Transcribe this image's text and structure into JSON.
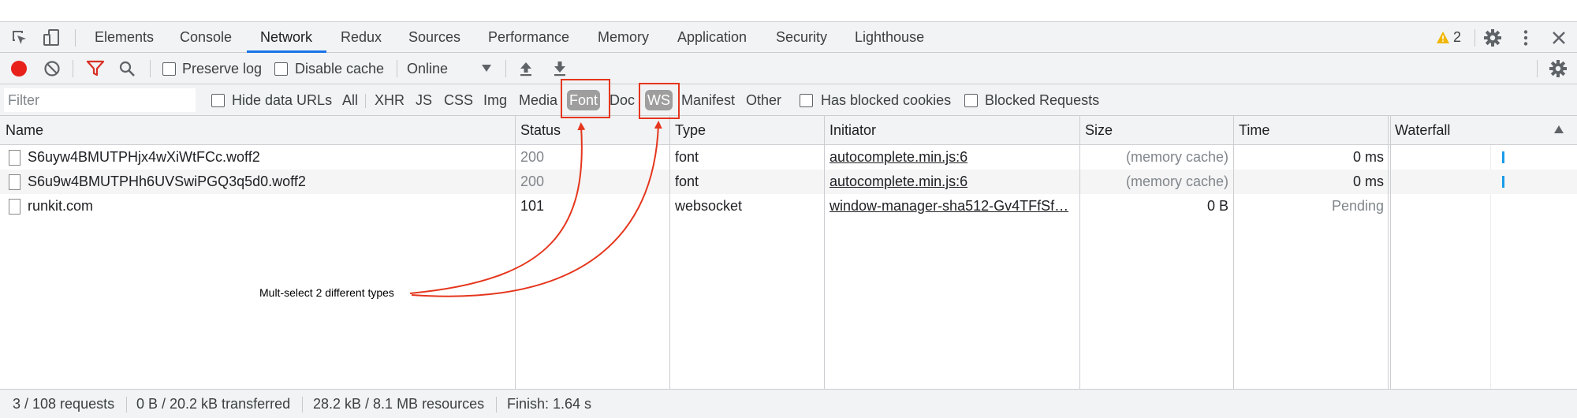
{
  "tabs": [
    {
      "label": "Elements"
    },
    {
      "label": "Console"
    },
    {
      "label": "Network",
      "active": true
    },
    {
      "label": "Redux"
    },
    {
      "label": "Sources"
    },
    {
      "label": "Performance"
    },
    {
      "label": "Memory"
    },
    {
      "label": "Application"
    },
    {
      "label": "Security"
    },
    {
      "label": "Lighthouse"
    }
  ],
  "warnings_count": "2",
  "toolbar": {
    "preserve_log": "Preserve log",
    "disable_cache": "Disable cache",
    "throttling": "Online"
  },
  "filter": {
    "placeholder": "Filter",
    "hide_data_urls": "Hide data URLs",
    "types": [
      "All",
      "XHR",
      "JS",
      "CSS",
      "Img",
      "Media",
      "Font",
      "Doc",
      "WS",
      "Manifest",
      "Other"
    ],
    "selected_types": [
      "Font",
      "WS"
    ],
    "has_blocked_cookies": "Has blocked cookies",
    "blocked_requests": "Blocked Requests"
  },
  "table": {
    "columns": [
      "Name",
      "Status",
      "Type",
      "Initiator",
      "Size",
      "Time",
      "Waterfall"
    ],
    "rows": [
      {
        "name": "S6uyw4BMUTPHjx4wXiWtFCc.woff2",
        "status": "200",
        "type": "font",
        "initiator": "autocomplete.min.js:6",
        "size": "(memory cache)",
        "time": "0 ms"
      },
      {
        "name": "S6u9w4BMUTPHh6UVSwiPGQ3q5d0.woff2",
        "status": "200",
        "type": "font",
        "initiator": "autocomplete.min.js:6",
        "size": "(memory cache)",
        "time": "0 ms"
      },
      {
        "name": "runkit.com",
        "status": "101",
        "type": "websocket",
        "initiator": "window-manager-sha512-Gv4TFfSf…",
        "size": "0 B",
        "time": "Pending"
      }
    ]
  },
  "status_bar": {
    "requests": "3 / 108 requests",
    "transferred": "0 B / 20.2 kB transferred",
    "resources": "28.2 kB / 8.1 MB resources",
    "finish": "Finish: 1.64 s"
  },
  "annotation": {
    "text": "Mult-select 2 different types",
    "color": "#e5361d"
  },
  "colors": {
    "accent": "#1a73e8",
    "record": "#e8211b",
    "filter_icon": "#d93025",
    "warning": "#f2b600",
    "waterfall_bar": "#1a9be8"
  }
}
